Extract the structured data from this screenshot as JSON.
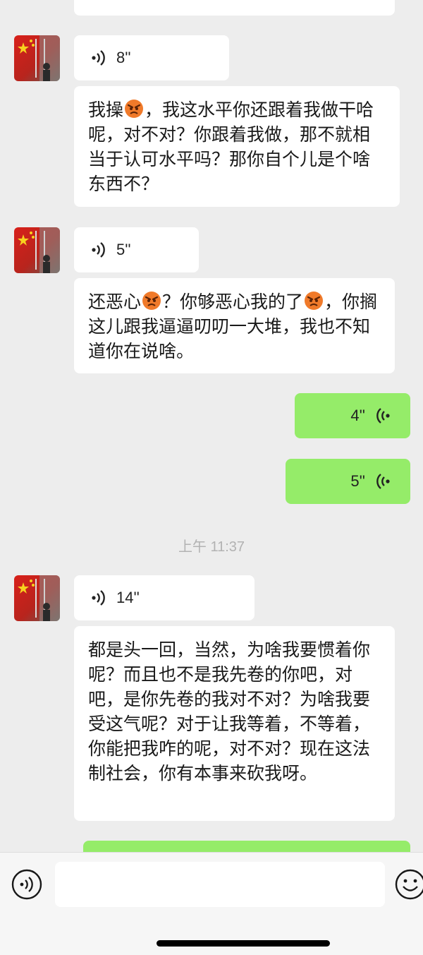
{
  "messages": [
    {
      "voice": "8''"
    },
    {
      "text_parts": [
        "我操",
        "，我这水平你还跟着我做干哈呢，对不对？你跟着我做，那不就相当于认可水平吗？那你自个儿是个啥东西不？"
      ]
    },
    {
      "voice": "5''"
    },
    {
      "text_parts": [
        "还恶心",
        "？你够恶心我的了",
        "，你搁这儿跟我逼逼叨叨一大堆，我也不知道你在说啥。"
      ]
    },
    {
      "voice": "4''"
    },
    {
      "voice": "5''"
    },
    {
      "voice": "14''"
    },
    {
      "text": "都是头一回，当然，为啥我要惯着你呢？而且也不是我先卷的你吧，对吧，是你先卷的我对不对？为啥我要受这气呢？对于让我等着，不等着，你能把我咋的呢，对不对？现在这法制社会，你有本事来砍我呀。"
    }
  ],
  "timestamp": "上午 11:37",
  "colors": {
    "background": "#ededed",
    "outgoing_bubble": "#95ec69",
    "incoming_bubble": "#ffffff",
    "timestamp": "#b2b2b2"
  },
  "icons": {
    "voice_incoming": "voice-wave-icon",
    "voice_outgoing": "voice-wave-icon",
    "emoji_angry": "angry-face-icon",
    "input_voice": "voice-mode-icon",
    "input_emoji": "emoji-icon"
  }
}
